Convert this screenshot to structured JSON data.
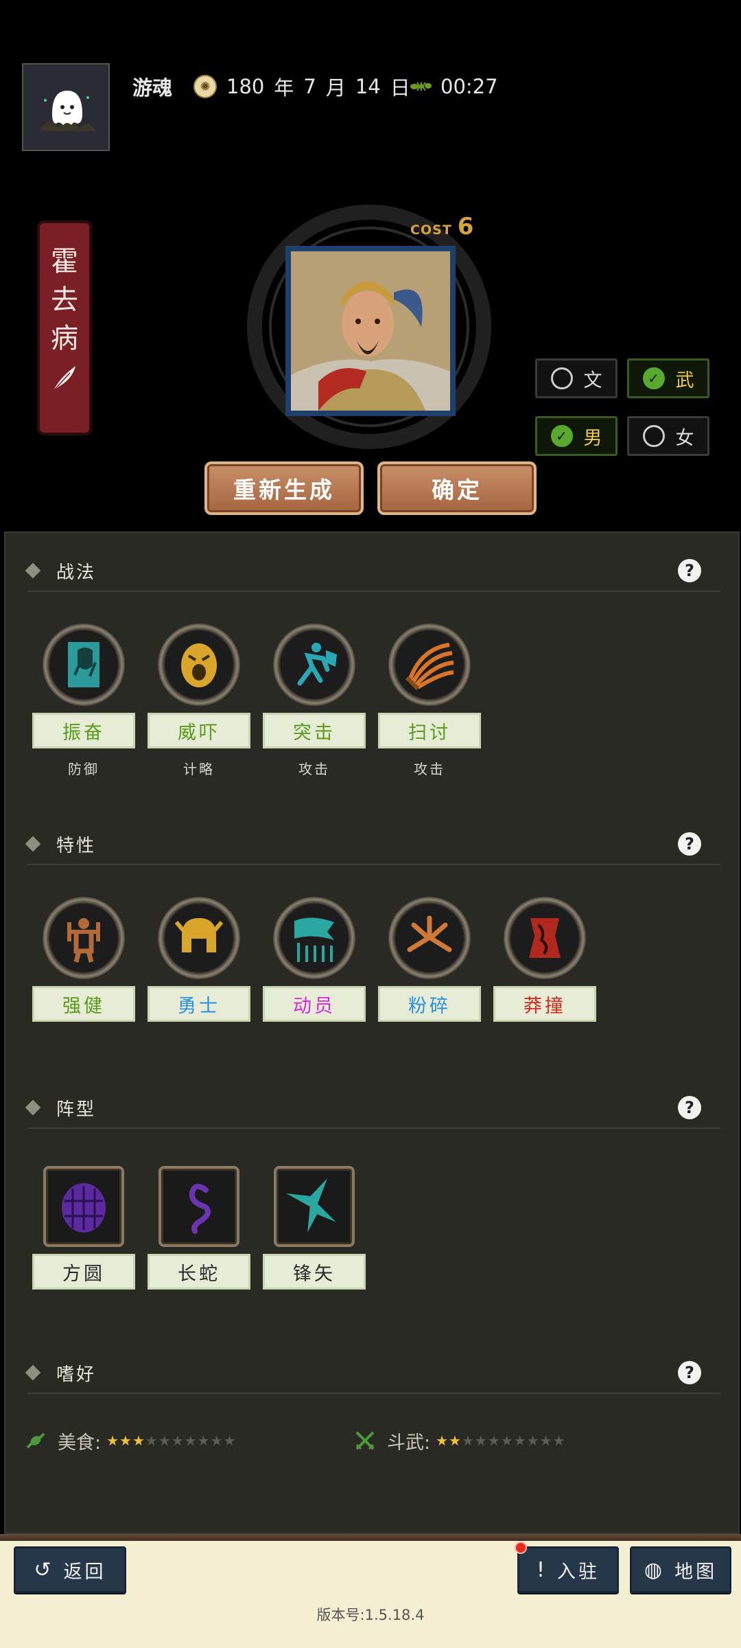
{
  "header": {
    "player_name": "游魂",
    "date": {
      "year": "180",
      "year_unit": "年",
      "month": "7",
      "month_unit": "月",
      "day": "14",
      "day_unit": "日"
    },
    "sun_icon": "sun-emblem-icon",
    "time_icon": "ant-icon",
    "time": "00:27"
  },
  "general": {
    "name_chars": [
      "霍",
      "去",
      "病"
    ],
    "cost_label": "COST",
    "cost_value": "6",
    "options": {
      "civil": "文",
      "military": "武",
      "male": "男",
      "female": "女"
    },
    "selected": {
      "civil": false,
      "military": true,
      "male": true,
      "female": false
    },
    "regenerate_label": "重新生成",
    "confirm_label": "确定"
  },
  "sections": {
    "tactics": {
      "title": "战法",
      "items": [
        {
          "name": "振奋",
          "type": "防御",
          "color": "#5a9a1c",
          "icon": "fortify-icon"
        },
        {
          "name": "威吓",
          "type": "计略",
          "color": "#5a9a1c",
          "icon": "intimidate-icon"
        },
        {
          "name": "突击",
          "type": "攻击",
          "color": "#5a9a1c",
          "icon": "charge-icon"
        },
        {
          "name": "扫讨",
          "type": "攻击",
          "color": "#5a9a1c",
          "icon": "sweep-icon"
        }
      ]
    },
    "traits": {
      "title": "特性",
      "items": [
        {
          "name": "强健",
          "color": "#5a9a1c",
          "icon": "strong-icon"
        },
        {
          "name": "勇士",
          "color": "#2b8fe0",
          "icon": "warrior-helmet-icon"
        },
        {
          "name": "动员",
          "color": "#d629d6",
          "icon": "mobilize-banner-icon"
        },
        {
          "name": "粉碎",
          "color": "#2b8fe0",
          "icon": "smash-icon"
        },
        {
          "name": "莽撞",
          "color": "#d42a1e",
          "icon": "reckless-icon"
        }
      ]
    },
    "formations": {
      "title": "阵型",
      "items": [
        {
          "name": "方圆",
          "icon": "turtle-shell-icon"
        },
        {
          "name": "长蛇",
          "icon": "snake-icon"
        },
        {
          "name": "锋矢",
          "icon": "arrowhead-icon"
        }
      ]
    },
    "hobbies": {
      "title": "嗜好",
      "items": [
        {
          "name": "美食:",
          "stars": 3,
          "max": 10,
          "icon": "candy-icon"
        },
        {
          "name": "斗武:",
          "stars": 2,
          "max": 10,
          "icon": "crossed-swords-icon"
        }
      ]
    },
    "help_glyph": "?"
  },
  "footer": {
    "back_label": "返回",
    "settle_label": "入驻",
    "map_label": "地图",
    "version": "版本号:1.5.18.4"
  }
}
